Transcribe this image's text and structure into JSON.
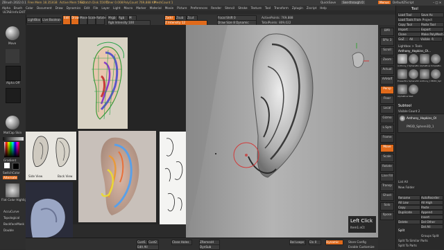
{
  "window": {
    "title": "ZBrush 2022.0.1",
    "stats": [
      "Free Mem 18.353GB",
      "Active Mem 5932",
      "Scratch Disk 55045",
      "Timer 0.008",
      "PolyCount 769,888 KP",
      "MeshCount 1"
    ],
    "right": [
      "QuickSave",
      "See-through 0",
      "Menus",
      "DefaultZScript"
    ]
  },
  "menu": [
    "Alpha",
    "Brush",
    "Color",
    "Document",
    "Draw",
    "Dynamics",
    "Edit",
    "File",
    "Layer",
    "Light",
    "Macro",
    "Marker",
    "Material",
    "Movie",
    "Picture",
    "Preferences",
    "Render",
    "Stencil",
    "Stroke",
    "Texture",
    "Tool",
    "Transform",
    "Zplugin",
    "Zscript",
    "Help"
  ],
  "infobar": "ULTAB:Info:EXIT",
  "toolbar": {
    "lightbox": "LightBox",
    "live_boolean": "Live Boolean",
    "edit": "Edit",
    "draw": "Draw",
    "move": "Move",
    "scale": "Scale",
    "rotate": "Rotate",
    "mrgb": "Mrgb",
    "rgb": "Rgb",
    "m": "M",
    "rgb_intensity": "Rgb Intensity 100",
    "zadd": "Zadd",
    "zsub": "Zsub",
    "zcut": "Zcut",
    "focal_shift": "Focal Shift 0",
    "draw_size": "Draw Size 8 Dynamic",
    "z_intensity": "Z Intensity 12",
    "active_points": "ActivePoints: 769,888",
    "total_points": "TotalPoints: 809,022"
  },
  "left_shelf": {
    "brush_label": "Move",
    "alpha_label": "Alpha Off",
    "material_label": "MatCap Skin",
    "gradient_label": "Gradient",
    "switch_color": "SwitchColor",
    "alternate": "Alternate",
    "texture_label": "Flat Color Highlight",
    "accucurve": "AccuCurve",
    "topological": "Topological",
    "backface_mask": "BackfaceMask",
    "double": "Double"
  },
  "reference": {
    "side_view": "Side View",
    "back_view": "Back View"
  },
  "viewport": {
    "overlay_title": "Left Click",
    "overlay_sub": "Item1.nCt"
  },
  "right_shelf": [
    "BPR",
    "SPix 3",
    "Scroll",
    "Zoom",
    "Actual",
    "AAHalf",
    "Persp",
    "Floor",
    "Local",
    "Gizmo",
    "L.Sym",
    "Frame",
    "Move",
    "Scale",
    "Rotate",
    "Line Fill",
    "Transp",
    "Ghost",
    "Solo",
    "Xpose"
  ],
  "right_panel": {
    "header": "Tool",
    "buttons": [
      [
        "Load Tool",
        "Save As"
      ],
      [
        "Load Tools From Project",
        ""
      ],
      [
        "Copy Tool",
        "Paste Tool"
      ],
      [
        "Import",
        "Export"
      ],
      [
        "Clone",
        "Make PolyMesh3D"
      ],
      [
        "GoZ",
        "All",
        "Visible",
        "R"
      ]
    ],
    "lightbox_tools": "Lightbox > Tools",
    "tool_name": "Anthony_Hopkins_Ol...",
    "tool_thumbs": [
      "Anthony_Hopkins_Ol",
      "SphereBrush",
      "AlphaBrush",
      "SimpleBrush",
      "EraserBrush",
      "Sphere3D",
      "Anthony_Hopkins",
      "PM3D_Sphere3D",
      "AlphaBrush",
      "Sket"
    ],
    "subtool": "Subtool",
    "visible_count": "Visible Count 2",
    "subtool_items": [
      "Anthony_Hopkins_Ol",
      "PM3D_Sphere3D_1"
    ],
    "list_all": "List All",
    "new_folder": "New Folder",
    "ops": [
      [
        "Rename",
        "AutoReorder"
      ],
      [
        "All Low",
        "All High"
      ],
      [
        "Copy",
        "Paste"
      ],
      [
        "Duplicate",
        "Append"
      ],
      [
        "",
        "Insert"
      ],
      [
        "Delete",
        "Del Other"
      ],
      [
        "",
        "Del All"
      ]
    ],
    "split": "Split",
    "split_actions": [
      [
        "",
        "Groups Split"
      ],
      [
        "Split To Similar Parts",
        ""
      ],
      [
        "Split To Parts",
        ""
      ]
    ]
  },
  "bottombar": {
    "cust1": "Cust1",
    "cust2": "Cust2",
    "edit_all": "Edit All",
    "close_holes": "Close Holes",
    "zremesher": "ZRemesH",
    "dyn_sub": "DynSub",
    "ball_loops": "Bal Loops",
    "elv": "Elv 0",
    "dynamic": "Dynamic",
    "store_config": "Store Config",
    "enable_customize": "Enable Customize"
  },
  "colors": {
    "accent": "#e06a1b",
    "panel": "#2a2a2a",
    "viewport_bg": "#9a9a9a"
  }
}
